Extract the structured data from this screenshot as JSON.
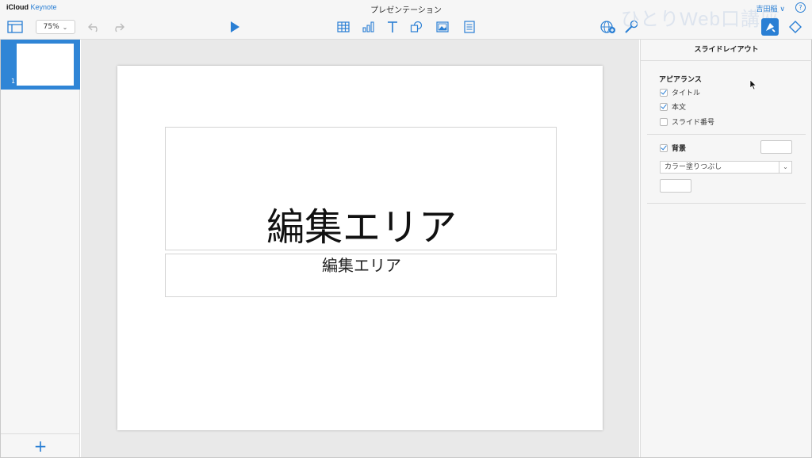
{
  "app": {
    "brand_primary": "iCloud",
    "brand_secondary": "Keynote",
    "document_title": "プレゼンテーション",
    "user_name": "吉田稲",
    "user_chevron": "∨",
    "help_label": "?",
    "watermark": "ひとりWeb口講座"
  },
  "toolbar": {
    "zoom_value": "75%",
    "zoom_chevron": "⌄",
    "icons": [
      "slide-view-icon",
      "undo-icon",
      "redo-icon",
      "play-icon",
      "table-icon",
      "chart-icon",
      "text-icon",
      "shape-icon",
      "media-icon",
      "comment-icon",
      "collaborate-icon",
      "tools-icon",
      "format-icon",
      "animate-icon"
    ]
  },
  "navigator": {
    "slides": [
      {
        "number": "1"
      }
    ],
    "add_label": "+"
  },
  "slide": {
    "title_text": "編集エリア",
    "body_text": "編集エリア"
  },
  "inspector": {
    "header": "スライドレイアウト",
    "appearance_title": "アピアランス",
    "appearance_options": [
      {
        "label": "タイトル",
        "checked": true
      },
      {
        "label": "本文",
        "checked": true
      },
      {
        "label": "スライド番号",
        "checked": false
      }
    ],
    "background_label": "背景",
    "background_checked": true,
    "fill_select_value": "カラー塗りつぶし",
    "fill_select_arrow": "⌄"
  },
  "colors": {
    "accent": "#2a7fd4",
    "toolbar_bg": "#f6f6f6",
    "canvas_bg": "#e9e9e9"
  }
}
